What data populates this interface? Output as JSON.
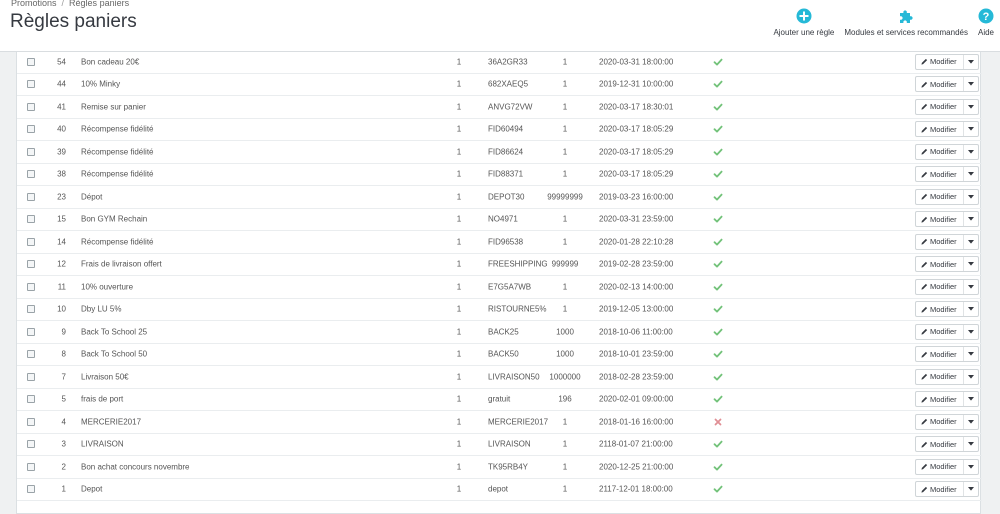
{
  "breadcrumb": {
    "items": [
      "Promotions",
      "Règles paniers"
    ],
    "separator": "/"
  },
  "page": {
    "title": "Règles paniers"
  },
  "toolbar": {
    "add_label": "Ajouter une règle",
    "modules_label": "Modules et services recommandés",
    "help_label": "Aide",
    "accent_color": "#25b9d7"
  },
  "colors": {
    "enabled": "#72c279",
    "disabled": "#e08f95"
  },
  "actions": {
    "edit_label": "Modifier"
  },
  "rows": [
    {
      "id": "54",
      "name": "Bon cadeau 20€",
      "priority": "1",
      "code": "36A2GR33",
      "quantity": "1",
      "expiration": "2020-03-31 18:00:00",
      "status": "enabled"
    },
    {
      "id": "44",
      "name": "10% Minky",
      "priority": "1",
      "code": "682XAEQ5",
      "quantity": "1",
      "expiration": "2019-12-31 10:00:00",
      "status": "enabled"
    },
    {
      "id": "41",
      "name": "Remise sur panier",
      "priority": "1",
      "code": "ANVG72VW",
      "quantity": "1",
      "expiration": "2020-03-17 18:30:01",
      "status": "enabled"
    },
    {
      "id": "40",
      "name": "Récompense fidélité",
      "priority": "1",
      "code": "FID60494",
      "quantity": "1",
      "expiration": "2020-03-17 18:05:29",
      "status": "enabled"
    },
    {
      "id": "39",
      "name": "Récompense fidélité",
      "priority": "1",
      "code": "FID86624",
      "quantity": "1",
      "expiration": "2020-03-17 18:05:29",
      "status": "enabled"
    },
    {
      "id": "38",
      "name": "Récompense fidélité",
      "priority": "1",
      "code": "FID88371",
      "quantity": "1",
      "expiration": "2020-03-17 18:05:29",
      "status": "enabled"
    },
    {
      "id": "23",
      "name": "Dépot",
      "priority": "1",
      "code": "DEPOT30",
      "quantity": "99999999",
      "expiration": "2019-03-23 16:00:00",
      "status": "enabled"
    },
    {
      "id": "15",
      "name": "Bon GYM Rechain",
      "priority": "1",
      "code": "NO4971",
      "quantity": "1",
      "expiration": "2020-03-31 23:59:00",
      "status": "enabled"
    },
    {
      "id": "14",
      "name": "Récompense fidélité",
      "priority": "1",
      "code": "FID96538",
      "quantity": "1",
      "expiration": "2020-01-28 22:10:28",
      "status": "enabled"
    },
    {
      "id": "12",
      "name": "Frais de livraison offert",
      "priority": "1",
      "code": "FREESHIPPING",
      "quantity": "999999",
      "expiration": "2019-02-28 23:59:00",
      "status": "enabled"
    },
    {
      "id": "11",
      "name": "10% ouverture",
      "priority": "1",
      "code": "E7G5A7WB",
      "quantity": "1",
      "expiration": "2020-02-13 14:00:00",
      "status": "enabled"
    },
    {
      "id": "10",
      "name": "Dby LU 5%",
      "priority": "1",
      "code": "RISTOURNE5%",
      "quantity": "1",
      "expiration": "2019-12-05 13:00:00",
      "status": "enabled"
    },
    {
      "id": "9",
      "name": "Back To School 25",
      "priority": "1",
      "code": "BACK25",
      "quantity": "1000",
      "expiration": "2018-10-06 11:00:00",
      "status": "enabled"
    },
    {
      "id": "8",
      "name": "Back To School 50",
      "priority": "1",
      "code": "BACK50",
      "quantity": "1000",
      "expiration": "2018-10-01 23:59:00",
      "status": "enabled"
    },
    {
      "id": "7",
      "name": "Livraison 50€",
      "priority": "1",
      "code": "LIVRAISON50",
      "quantity": "1000000",
      "expiration": "2018-02-28 23:59:00",
      "status": "enabled"
    },
    {
      "id": "5",
      "name": "frais de port",
      "priority": "1",
      "code": "gratuit",
      "quantity": "196",
      "expiration": "2020-02-01 09:00:00",
      "status": "enabled"
    },
    {
      "id": "4",
      "name": "MERCERIE2017",
      "priority": "1",
      "code": "MERCERIE2017",
      "quantity": "1",
      "expiration": "2018-01-16 16:00:00",
      "status": "disabled"
    },
    {
      "id": "3",
      "name": "LIVRAISON",
      "priority": "1",
      "code": "LIVRAISON",
      "quantity": "1",
      "expiration": "2118-01-07 21:00:00",
      "status": "enabled"
    },
    {
      "id": "2",
      "name": "Bon achat concours novembre",
      "priority": "1",
      "code": "TK95RB4Y",
      "quantity": "1",
      "expiration": "2020-12-25 21:00:00",
      "status": "enabled"
    },
    {
      "id": "1",
      "name": "Depot",
      "priority": "1",
      "code": "depot",
      "quantity": "1",
      "expiration": "2117-12-01 18:00:00",
      "status": "enabled"
    }
  ]
}
